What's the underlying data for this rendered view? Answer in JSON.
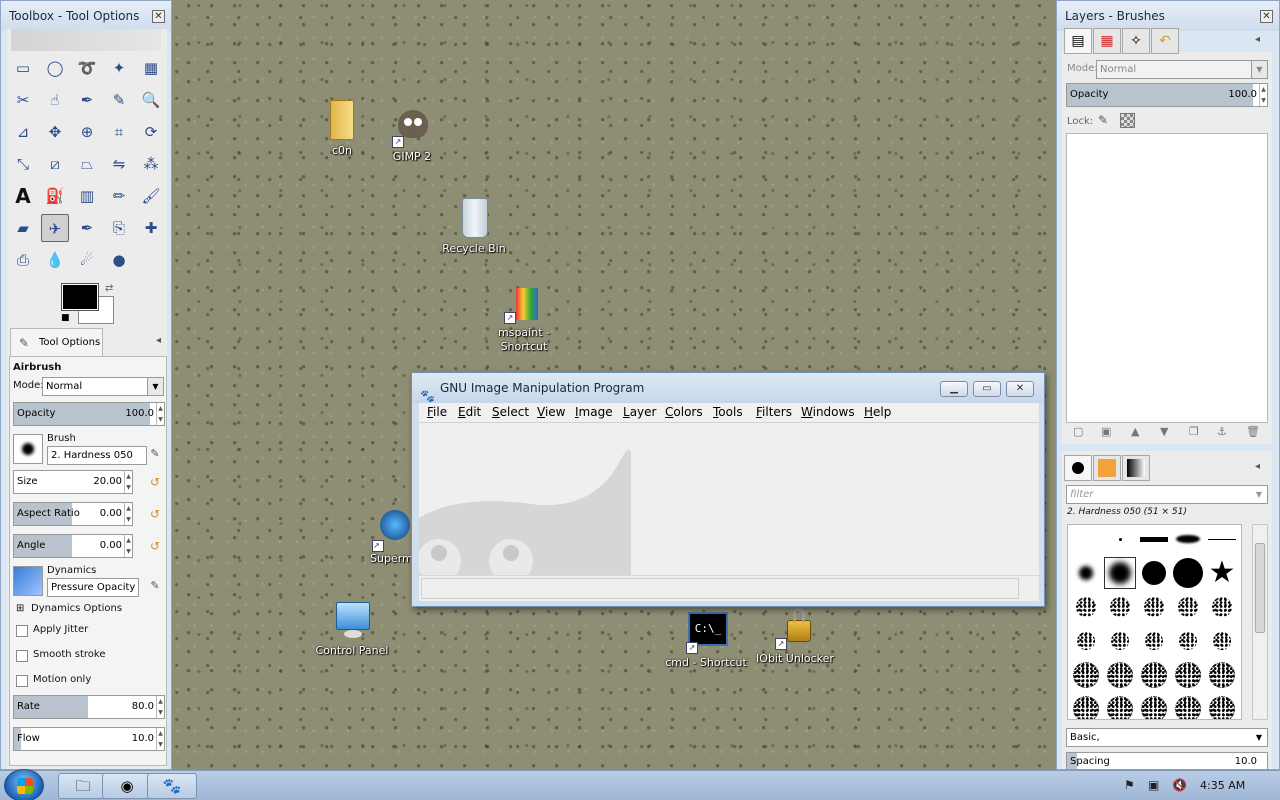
{
  "toolbox": {
    "title": "Toolbox - Tool Options",
    "tab_label": "Tool Options",
    "tool_name": "Airbrush",
    "mode_label": "Mode:",
    "mode_value": "Normal",
    "opacity_label": "Opacity",
    "opacity_value": "100.0",
    "opacity_fraction": 1.0,
    "brush_label": "Brush",
    "brush_value": "2. Hardness 050",
    "size_label": "Size",
    "size_value": "20.00",
    "aspect_label": "Aspect Ratio",
    "aspect_value": "0.00",
    "angle_label": "Angle",
    "angle_value": "0.00",
    "dynamics_label": "Dynamics",
    "dynamics_value": "Pressure Opacity",
    "dynamics_options_label": "Dynamics Options",
    "apply_jitter_label": "Apply Jitter",
    "smooth_stroke_label": "Smooth stroke",
    "motion_only_label": "Motion only",
    "rate_label": "Rate",
    "rate_value": "80.0",
    "rate_fraction": 0.5,
    "flow_label": "Flow",
    "flow_value": "10.0",
    "flow_fraction": 0.05
  },
  "right_dock": {
    "title": "Layers - Brushes",
    "mode_label": "Mode:",
    "mode_value": "Normal",
    "opacity_label": "Opacity",
    "opacity_value": "100.0",
    "lock_label": "Lock:",
    "filter_placeholder": "filter",
    "brush_info": "2. Hardness 050 (51 × 51)",
    "brush_tag": "Basic,",
    "spacing_label": "Spacing",
    "spacing_value": "10.0"
  },
  "desktop_icons": [
    {
      "label": "c0n"
    },
    {
      "label": "GIMP 2"
    },
    {
      "label": "Recycle Bin"
    },
    {
      "label": "mspaint - Shortcut"
    },
    {
      "label": "Superm"
    },
    {
      "label": "Control Panel"
    },
    {
      "label": "cmd - Shortcut"
    },
    {
      "label": "IObit Unlocker"
    }
  ],
  "gimp_window": {
    "title": "GNU Image Manipulation Program",
    "menus": [
      {
        "mnemonic": "F",
        "rest": "ile"
      },
      {
        "mnemonic": "E",
        "rest": "dit"
      },
      {
        "mnemonic": "S",
        "rest": "elect"
      },
      {
        "mnemonic": "V",
        "rest": "iew"
      },
      {
        "mnemonic": "I",
        "rest": "mage"
      },
      {
        "mnemonic": "L",
        "rest": "ayer"
      },
      {
        "mnemonic": "C",
        "rest": "olors"
      },
      {
        "mnemonic": "T",
        "rest": "ools"
      },
      {
        "mnemonic": "F",
        "rest": "ilters"
      },
      {
        "mnemonic": "W",
        "rest": "indows"
      },
      {
        "mnemonic": "H",
        "rest": "elp"
      }
    ]
  },
  "taskbar": {
    "clock": "4:35 AM"
  },
  "icons": {
    "tools": [
      "rect-select-icon",
      "ellipse-select-icon",
      "free-select-icon",
      "fuzzy-select-icon",
      "color-select-icon",
      "scissors-icon",
      "foreground-select-icon",
      "paths-icon",
      "color-picker-icon",
      "zoom-icon",
      "measure-icon",
      "move-icon",
      "align-icon",
      "crop-icon",
      "rotate-icon",
      "scale-icon",
      "shear-icon",
      "perspective-icon",
      "flip-icon",
      "cage-icon",
      "text-icon",
      "bucket-fill-icon",
      "blend-icon",
      "pencil-icon",
      "paintbrush-icon",
      "eraser-icon",
      "airbrush-icon",
      "ink-icon",
      "clone-icon",
      "heal-icon",
      "perspective-clone-icon",
      "blur-icon",
      "smudge-icon",
      "dodge-burn-icon"
    ]
  }
}
